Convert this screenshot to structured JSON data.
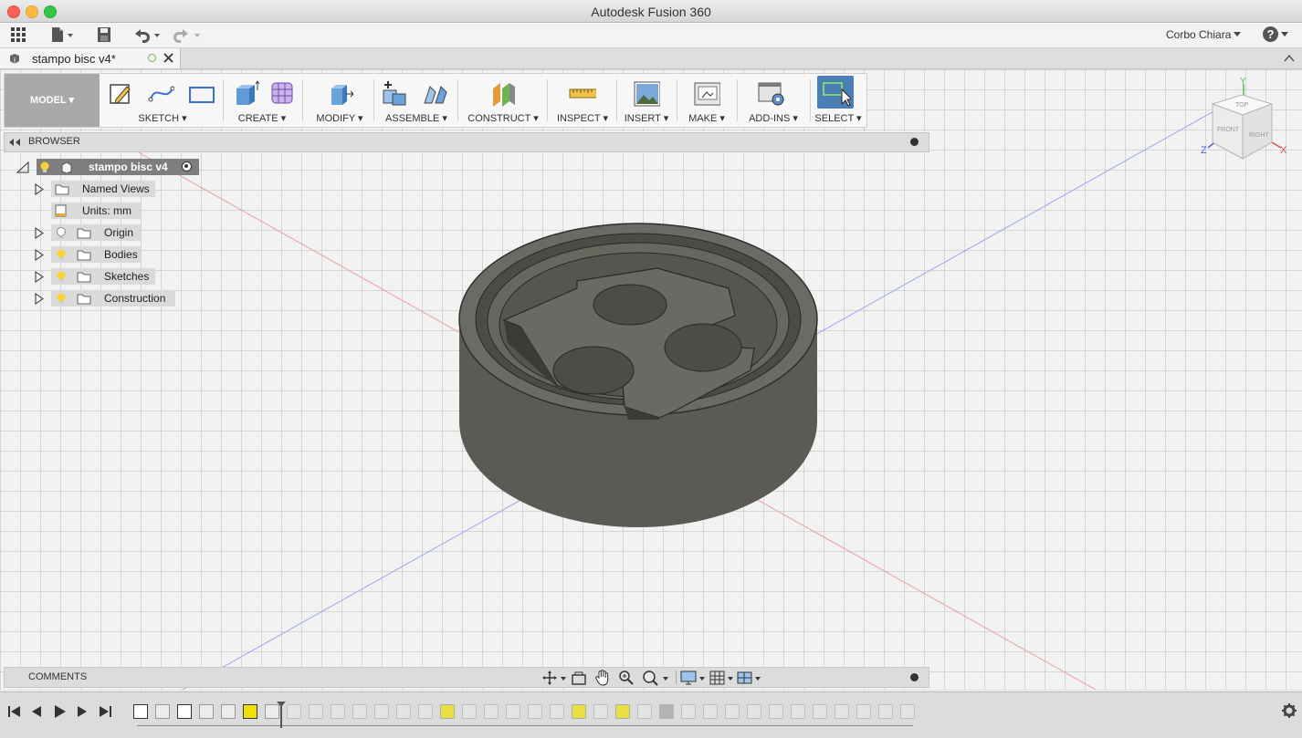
{
  "window": {
    "title": "Autodesk Fusion 360"
  },
  "appbar": {
    "user_name": "Corbo Chiara",
    "help_label": "?"
  },
  "tab": {
    "name": "stampo bisc v4*"
  },
  "toolbar": {
    "workspace": "MODEL",
    "groups": [
      {
        "label": "SKETCH"
      },
      {
        "label": "CREATE"
      },
      {
        "label": "MODIFY"
      },
      {
        "label": "ASSEMBLE"
      },
      {
        "label": "CONSTRUCT"
      },
      {
        "label": "INSPECT"
      },
      {
        "label": "INSERT"
      },
      {
        "label": "MAKE"
      },
      {
        "label": "ADD-INS"
      },
      {
        "label": "SELECT"
      }
    ]
  },
  "browser": {
    "title": "BROWSER",
    "root": "stampo bisc v4",
    "items": [
      {
        "label": "Named Views"
      },
      {
        "label": "Units: mm"
      },
      {
        "label": "Origin"
      },
      {
        "label": "Bodies"
      },
      {
        "label": "Sketches"
      },
      {
        "label": "Construction"
      }
    ]
  },
  "viewcube": {
    "top": "TOP",
    "front": "FRONT",
    "right": "RIGHT",
    "axis_x": "X",
    "axis_y": "Y",
    "axis_z": "Z"
  },
  "comments": {
    "title": "COMMENTS"
  },
  "colors": {
    "accent": "#4a7eb5",
    "highlight": "#f0e000",
    "model": "#5e5d58"
  }
}
